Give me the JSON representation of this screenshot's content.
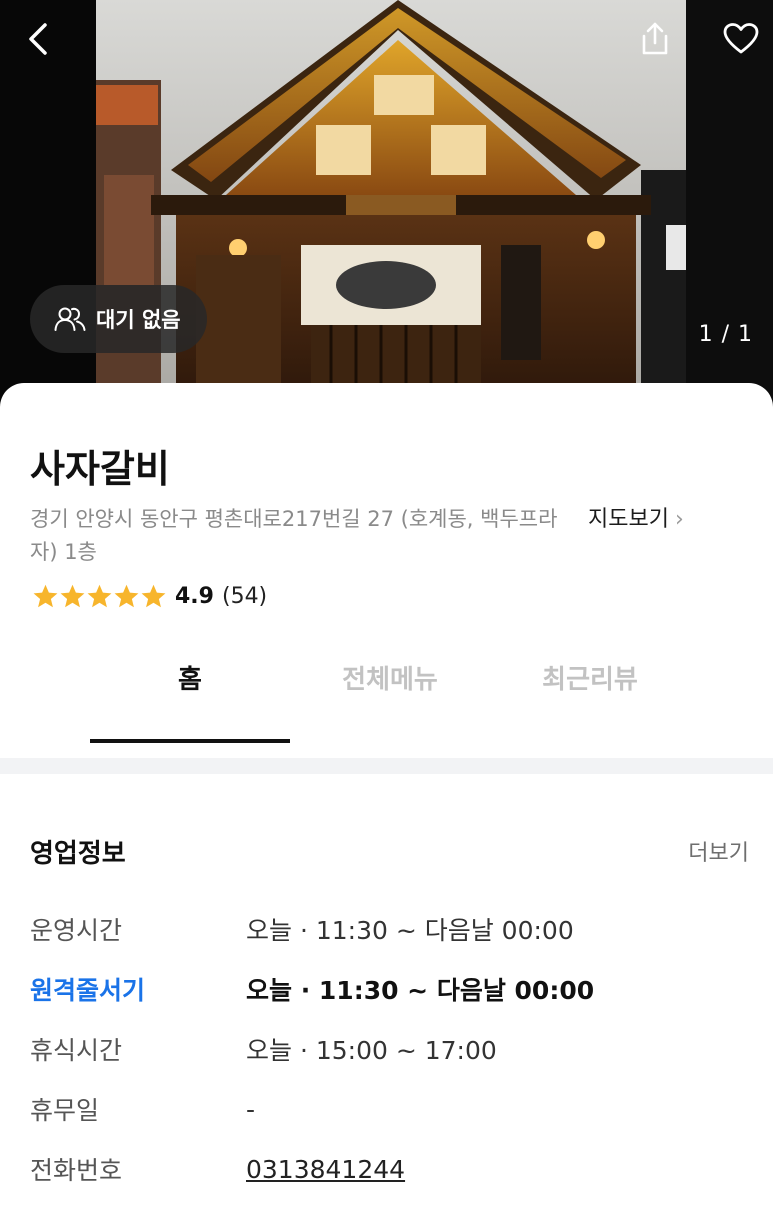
{
  "hero": {
    "wait_status": "대기 없음",
    "photo_counter": "1 / 1",
    "icons": {
      "back": "back-arrow-icon",
      "share": "share-icon",
      "favorite": "heart-icon",
      "wait": "people-icon"
    }
  },
  "store": {
    "name": "사자갈비",
    "address": "경기 안양시 동안구 평촌대로217번길 27 (호계동, 백두프라자) 1층",
    "map_link": "지도보기",
    "rating": {
      "stars": 5,
      "score": "4.9",
      "count": "(54)",
      "star_color": "#F7B52C"
    }
  },
  "tabs": [
    {
      "label": "홈",
      "active": true
    },
    {
      "label": "전체메뉴",
      "active": false
    },
    {
      "label": "최근리뷰",
      "active": false
    }
  ],
  "business_info": {
    "title": "영업정보",
    "more": "더보기",
    "rows": [
      {
        "label": "운영시간",
        "value": "오늘 · 11:30 ~ 다음날 00:00"
      },
      {
        "label": "원격줄서기",
        "value": "오늘 · 11:30 ~ 다음날 00:00"
      },
      {
        "label": "휴식시간",
        "value": "오늘 · 15:00 ~ 17:00"
      },
      {
        "label": "휴무일",
        "value": "-"
      },
      {
        "label": "전화번호",
        "value": "0313841244"
      }
    ]
  },
  "colors": {
    "accent": "#1A73E8",
    "tab_active": "#111111",
    "tab_inactive": "#C2C2C2"
  }
}
